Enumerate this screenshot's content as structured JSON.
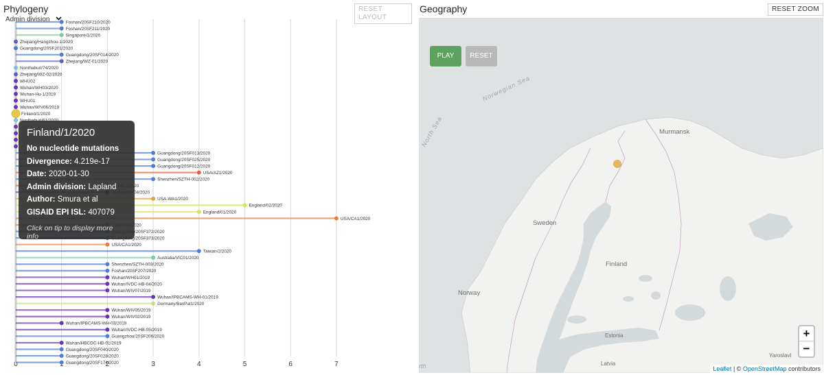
{
  "phylogeny": {
    "title": "Phylogeny",
    "reset_layout_label": "RESET LAYOUT",
    "color_by_label": "Admin division",
    "axis_ticks": [
      "0",
      "1",
      "2",
      "3",
      "4",
      "5",
      "6",
      "7"
    ],
    "tips": [
      {
        "label": "Foshan/20SF210/2020",
        "x": 1.0,
        "color": "#4d7dd9"
      },
      {
        "label": "Foshan/20SF211/2020",
        "x": 1.0,
        "color": "#4d7dd9"
      },
      {
        "label": "Singapore/1/2020",
        "x": 1.0,
        "color": "#7ccaa0"
      },
      {
        "label": "Zhejiang/Hangzhou-1/2020",
        "x": 0.0,
        "color": "#5c5bd0"
      },
      {
        "label": "Guangdong/20SF201/2020",
        "x": 0.0,
        "color": "#4d7dd9"
      },
      {
        "label": "Guangdong/20SF014/2020",
        "x": 1.0,
        "color": "#4d7dd9"
      },
      {
        "label": "Zhejiang/WZ-01/2020",
        "x": 1.0,
        "color": "#5c5bd0"
      },
      {
        "label": "Nonthaburi/74/2020",
        "x": 0.0,
        "color": "#7cc1d9"
      },
      {
        "label": "Zhejiang/WZ-02/2020",
        "x": 0.0,
        "color": "#5c5bd0"
      },
      {
        "label": "WHU02",
        "x": 0.0,
        "color": "#6a35b5"
      },
      {
        "label": "Wuhan/WH03/2020",
        "x": 0.0,
        "color": "#6a35b5"
      },
      {
        "label": "Wuhan-Hu-1/2019",
        "x": 0.0,
        "color": "#6a35b5"
      },
      {
        "label": "WHU01",
        "x": 0.0,
        "color": "#6a35b5"
      },
      {
        "label": "Wuhan/WIV06/2019",
        "x": 0.0,
        "color": "#6a35b5"
      },
      {
        "label": "Finland/1/2020",
        "x": 0.0,
        "color": "#e7c84a"
      },
      {
        "label": "Nonthaburi/61/2020",
        "x": 0.0,
        "color": "#7cc1d9"
      },
      {
        "label": "",
        "x": 0.0,
        "color": "#6a35b5"
      },
      {
        "label": "",
        "x": 0.0,
        "color": "#6a35b5"
      },
      {
        "label": "",
        "x": 0.0,
        "color": "#6a35b5"
      },
      {
        "label": "",
        "x": 0.0,
        "color": "#6a35b5"
      },
      {
        "label": "Guangdong/20SF013/2020",
        "x": 3.0,
        "color": "#4d7dd9"
      },
      {
        "label": "Guangdong/20SF025/2020",
        "x": 3.0,
        "color": "#4d7dd9"
      },
      {
        "label": "Guangdong/20SF012/2020",
        "x": 3.0,
        "color": "#4d7dd9"
      },
      {
        "label": "USA/AZ1/2020",
        "x": 4.0,
        "color": "#e8613c"
      },
      {
        "label": "Shenzhen/SZTH-002/2020",
        "x": 3.0,
        "color": "#4d7dd9"
      },
      {
        "label": "USA/IL1/2020",
        "x": 2.0,
        "color": "#e8613c"
      },
      {
        "label": "Wuhan/WH04/2020",
        "x": 2.0,
        "color": "#6a35b5"
      },
      {
        "label": "USA-WA1/2020",
        "x": 3.0,
        "color": "#e8a13c"
      },
      {
        "label": "England/02/2020",
        "x": 5.0,
        "color": "#d9e05b"
      },
      {
        "label": "England/01/2020",
        "x": 4.0,
        "color": "#d9e05b"
      },
      {
        "label": "USA/CA1/2020",
        "x": 7.0,
        "color": "#e8803c"
      },
      {
        "label": "USA/CA2/2020",
        "x": 2.0,
        "color": "#e8803c"
      },
      {
        "label": "Guangdong/20SF372/2020",
        "x": 2.0,
        "color": "#4d7dd9"
      },
      {
        "label": "Guangdong/20SF373/2020",
        "x": 2.0,
        "color": "#4d7dd9"
      },
      {
        "label": "USA/CA1/2020",
        "x": 2.0,
        "color": "#e8803c"
      },
      {
        "label": "Taiwan/2/2020",
        "x": 4.0,
        "color": "#4d7dd9"
      },
      {
        "label": "Australia/VIC01/2020",
        "x": 3.0,
        "color": "#7ccaa0"
      },
      {
        "label": "Shenzhen/SZTH-003/2020",
        "x": 2.0,
        "color": "#4d7dd9"
      },
      {
        "label": "Foshan/20SF207/2020",
        "x": 2.0,
        "color": "#4d7dd9"
      },
      {
        "label": "Wuhan/WH01/2019",
        "x": 2.0,
        "color": "#6a35b5"
      },
      {
        "label": "Wuhan/IVDC-HB-04/2020",
        "x": 2.0,
        "color": "#6a35b5"
      },
      {
        "label": "Wuhan/WIV07/2019",
        "x": 2.0,
        "color": "#6a35b5"
      },
      {
        "label": "Wuhan/IPBCAMS-WH-01/2019",
        "x": 3.0,
        "color": "#6a35b5"
      },
      {
        "label": "Germany/BavPat1/2020",
        "x": 3.0,
        "color": "#c9de7a"
      },
      {
        "label": "Wuhan/WIV05/2019",
        "x": 2.0,
        "color": "#6a35b5"
      },
      {
        "label": "Wuhan/WIV02/2019",
        "x": 2.0,
        "color": "#6a35b5"
      },
      {
        "label": "Wuhan/IPBCAMS-WH-03/2019",
        "x": 1.0,
        "color": "#6a35b5"
      },
      {
        "label": "Wuhan/IVDC-HB-05/2019",
        "x": 2.0,
        "color": "#6a35b5"
      },
      {
        "label": "Guangzhou/20SF206/2020",
        "x": 2.0,
        "color": "#4d7dd9"
      },
      {
        "label": "Wuhan/HBCDC-HB-01/2019",
        "x": 1.0,
        "color": "#6a35b5"
      },
      {
        "label": "Guangdong/20SF040/2020",
        "x": 1.0,
        "color": "#4d7dd9"
      },
      {
        "label": "Guangdong/20SF028/2020",
        "x": 1.0,
        "color": "#4d7dd9"
      },
      {
        "label": "Guangdong/20SF174/2020",
        "x": 1.0,
        "color": "#4d7dd9"
      }
    ],
    "selected_tip": "Finland/1/2020"
  },
  "tooltip": {
    "title": "Finland/1/2020",
    "mutations": "No nucleotide mutations",
    "divergence_label": "Divergence:",
    "divergence_value": "4.219e-17",
    "date_label": "Date:",
    "date_value": "2020-01-30",
    "admin_label": "Admin division:",
    "admin_value": "Lapland",
    "author_label": "Author:",
    "author_value": "Smura et al",
    "gisaid_label": "GISAID EPI ISL:",
    "gisaid_value": "407079",
    "hint": "Click on tip to display more info"
  },
  "geography": {
    "title": "Geography",
    "reset_zoom_label": "RESET ZOOM",
    "play_label": "PLAY",
    "reset_label": "RESET",
    "zoom_in": "+",
    "zoom_out": "−",
    "attribution_leaflet": "Leaflet",
    "attribution_sep": " | © ",
    "attribution_osm": "OpenStreetMap",
    "attribution_rest": " contributors",
    "place_labels": {
      "norwegian_sea": "Norwegian Sea",
      "north_sea": "North Sea",
      "murmansk": "Murmansk",
      "sweden": "Sweden",
      "finland": "Finland",
      "norway": "Norway",
      "estonia": "Estonia",
      "latvia": "Latvia",
      "yaroslavl": "Yaroslavl",
      "edge_fragment": "rth"
    },
    "colors": {
      "play": "#5da25f",
      "reset": "#b8b8b8",
      "marker": "#e7b75a",
      "land": "#f2f2f0",
      "water": "#d4dadc"
    }
  }
}
